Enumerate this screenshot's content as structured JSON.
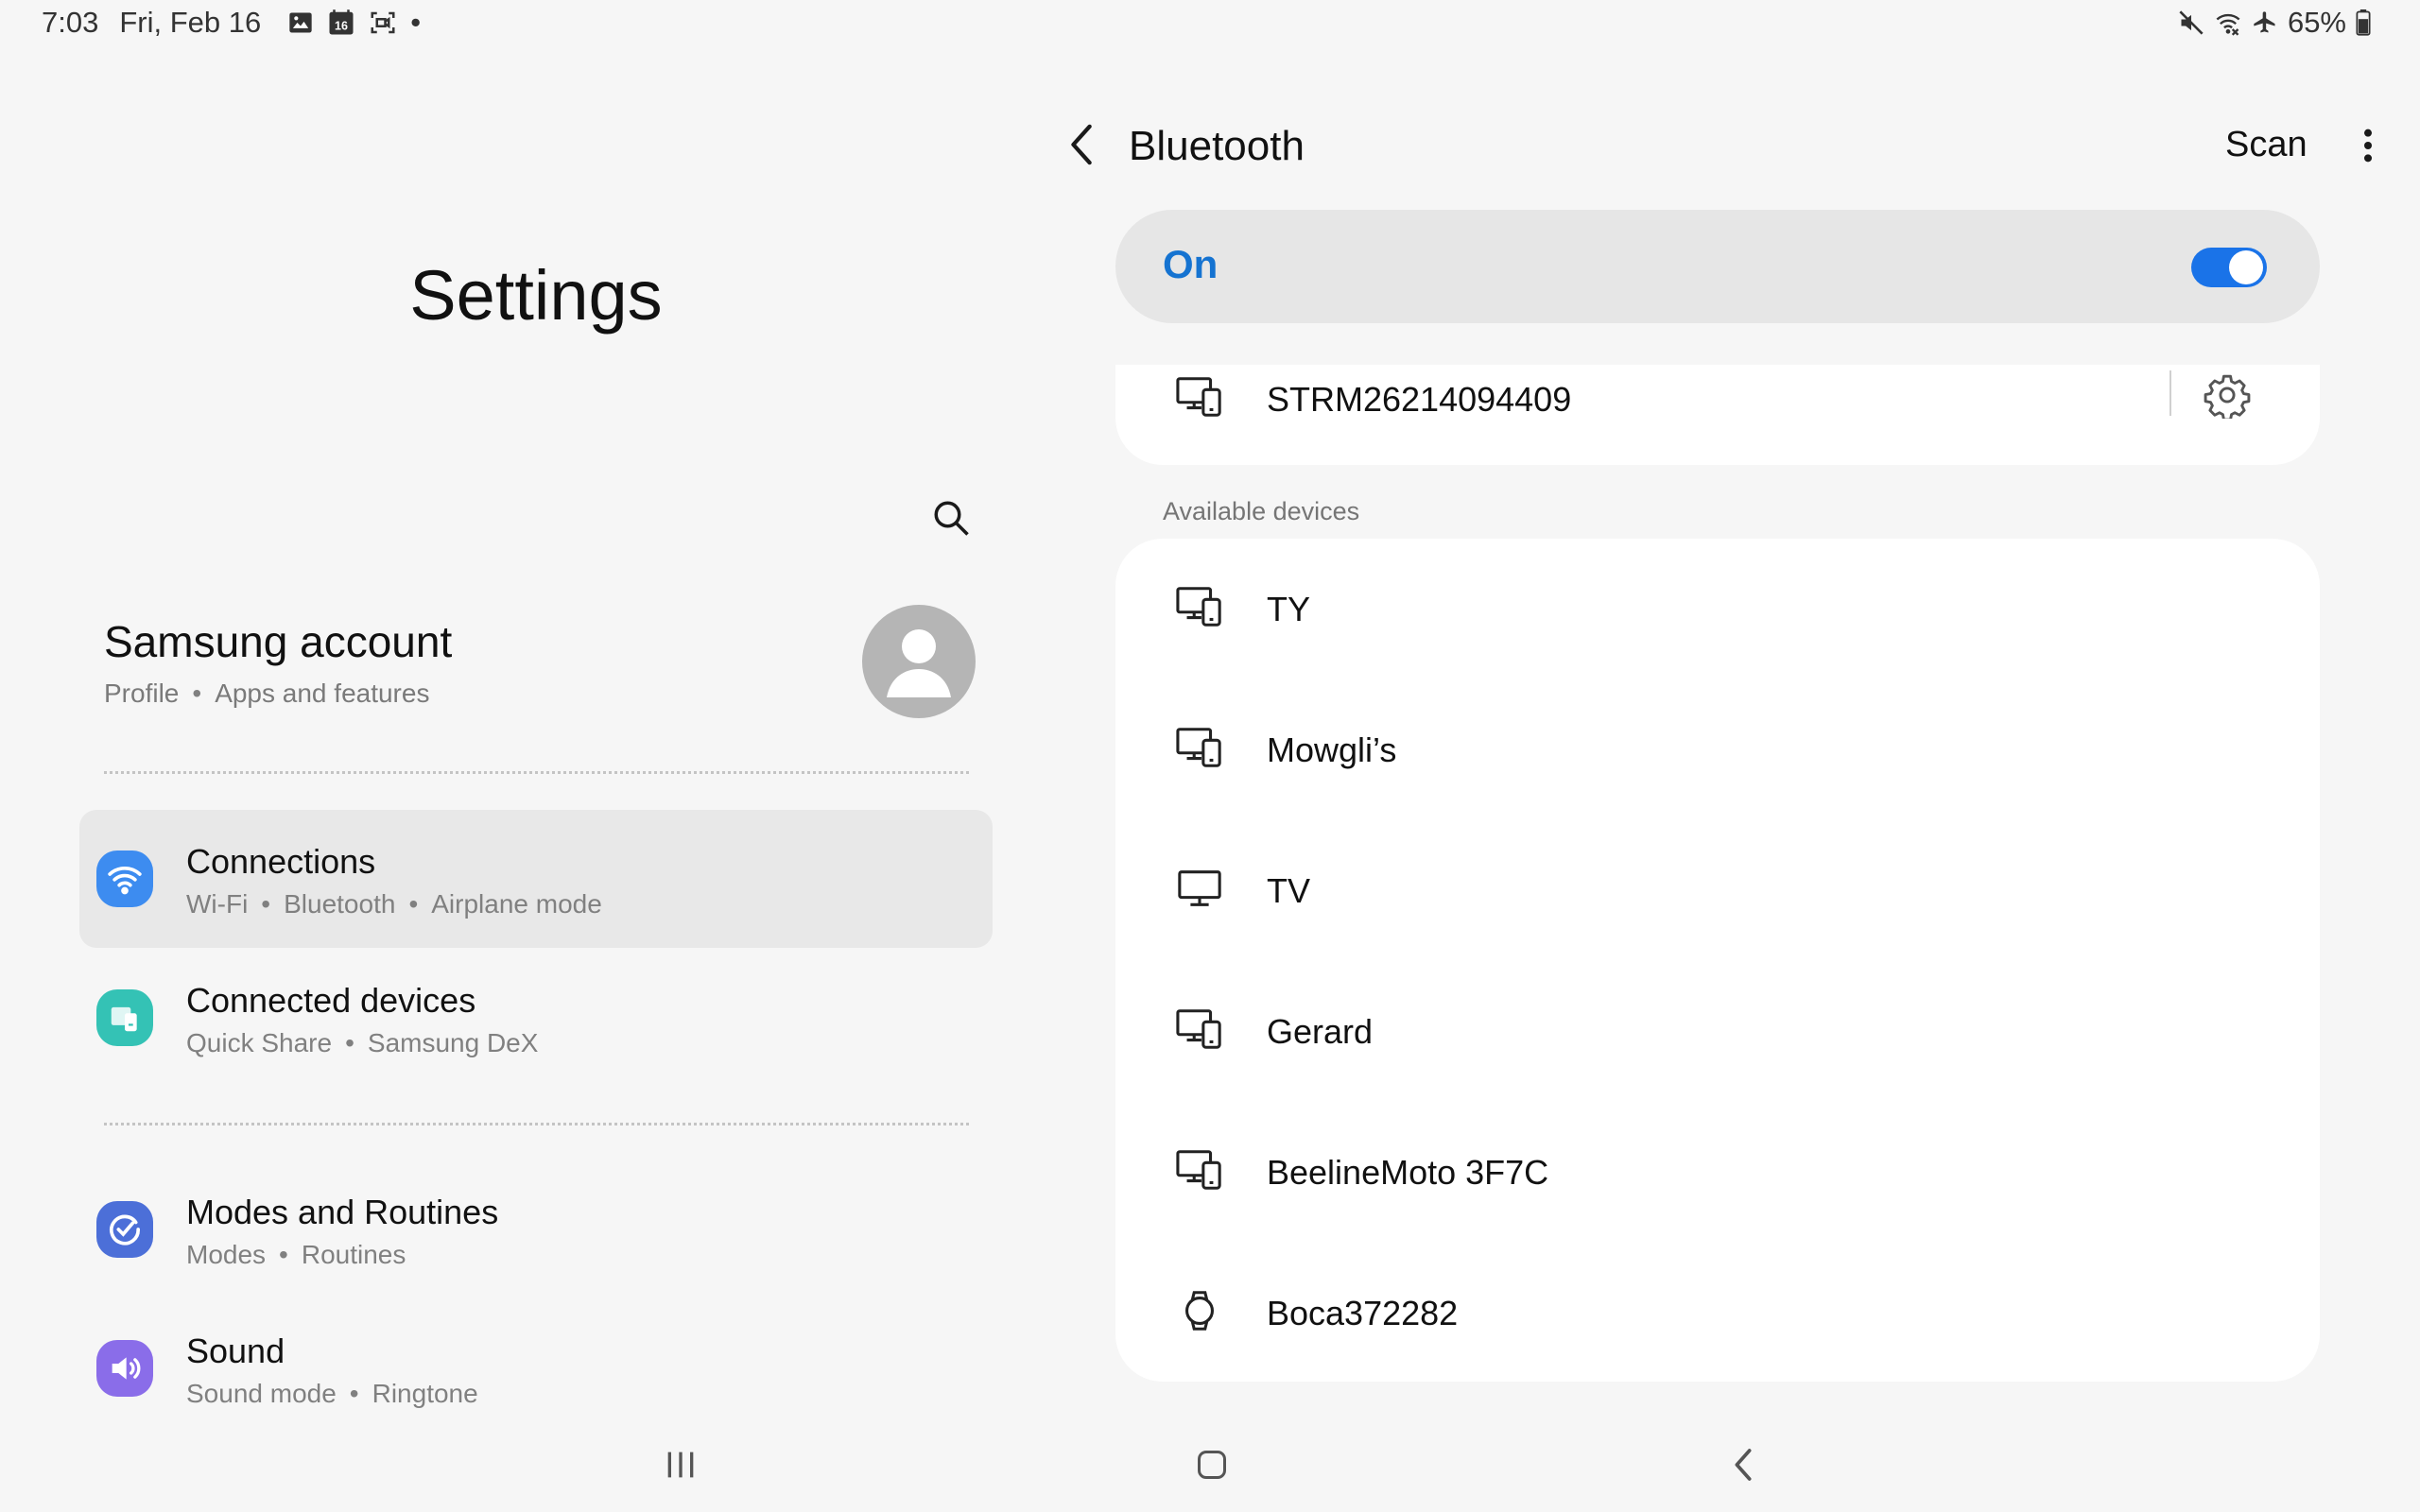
{
  "status_bar": {
    "time": "7:03",
    "date": "Fri, Feb 16",
    "calendar_badge": "16",
    "dot": "•",
    "battery": "65%"
  },
  "left": {
    "title": "Settings",
    "account": {
      "title": "Samsung account",
      "sub1": "Profile",
      "sub2": "Apps and features"
    },
    "menu": [
      {
        "title": "Connections",
        "sub": [
          "Wi-Fi",
          "Bluetooth",
          "Airplane mode"
        ],
        "icon": "wifi-icon",
        "color": "#3d8cf0"
      },
      {
        "title": "Connected devices",
        "sub": [
          "Quick Share",
          "Samsung DeX"
        ],
        "icon": "connected-devices-icon",
        "color": "#34c2b5"
      },
      {
        "title": "Modes and Routines",
        "sub": [
          "Modes",
          "Routines"
        ],
        "icon": "check-circle-icon",
        "color": "#4c6fd8"
      },
      {
        "title": "Sound",
        "sub": [
          "Sound mode",
          "Ringtone"
        ],
        "icon": "speaker-icon",
        "color": "#8a6de9"
      }
    ]
  },
  "right": {
    "title": "Bluetooth",
    "scan": "Scan",
    "toggle": {
      "label": "On",
      "state": true
    },
    "paired_device": "STRM26214094409",
    "available_label": "Available devices",
    "devices": [
      {
        "name": "TY",
        "icon": "devices-icon"
      },
      {
        "name": "Mowgli’s",
        "icon": "devices-icon"
      },
      {
        "name": "TV",
        "icon": "monitor-icon"
      },
      {
        "name": "Gerard",
        "icon": "devices-icon"
      },
      {
        "name": "BeelineMoto 3F7C",
        "icon": "devices-icon"
      },
      {
        "name": "Boca372282",
        "icon": "watch-icon"
      }
    ]
  },
  "colors": {
    "accent": "#1a73e8",
    "toggle_label": "#1573d1",
    "selected_bg": "#e8e8e8"
  }
}
